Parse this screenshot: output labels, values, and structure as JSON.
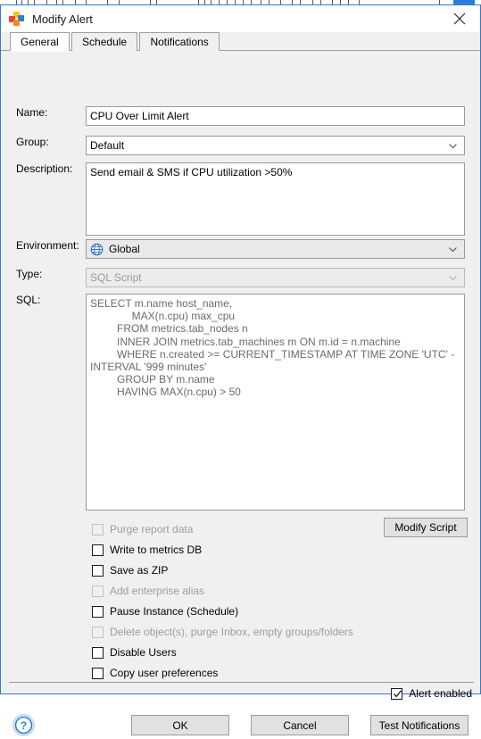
{
  "window": {
    "title": "Modify Alert",
    "app_icon": "squares-logo-icon",
    "close_label": "×"
  },
  "tabs": [
    {
      "label": "General",
      "active": true
    },
    {
      "label": "Schedule",
      "active": false
    },
    {
      "label": "Notifications",
      "active": false
    }
  ],
  "form": {
    "name": {
      "label": "Name:",
      "value": "CPU Over Limit Alert",
      "placeholder": ""
    },
    "group": {
      "label": "Group:",
      "value": "Default"
    },
    "description": {
      "label": "Description:",
      "value": "Send email & SMS if CPU utilization >50%",
      "placeholder": ""
    },
    "environment": {
      "label": "Environment:",
      "value": "Global",
      "icon": "globe-icon"
    },
    "type": {
      "label": "Type:",
      "value": "SQL Script",
      "disabled": true
    },
    "sql": {
      "label": "SQL:",
      "value": "SELECT m.name host_name,\n              MAX(n.cpu) max_cpu\n         FROM metrics.tab_nodes n\n         INNER JOIN metrics.tab_machines m ON m.id = n.machine\n         WHERE n.created >= CURRENT_TIMESTAMP AT TIME ZONE 'UTC' -\nINTERVAL '999 minutes'\n         GROUP BY m.name\n         HAVING MAX(n.cpu) > 50"
    }
  },
  "modify_script_button": "Modify Script",
  "checkboxes": [
    {
      "label": "Purge report data",
      "checked": false,
      "disabled": true
    },
    {
      "label": "Write to metrics DB",
      "checked": false,
      "disabled": false
    },
    {
      "label": "Save as ZIP",
      "checked": false,
      "disabled": false
    },
    {
      "label": "Add enterprise alias",
      "checked": false,
      "disabled": true
    },
    {
      "label": "Pause Instance (Schedule)",
      "checked": false,
      "disabled": false
    },
    {
      "label": "Delete object(s), purge Inbox, empty groups/folders",
      "checked": false,
      "disabled": true
    },
    {
      "label": "Disable Users",
      "checked": false,
      "disabled": false
    },
    {
      "label": "Copy user preferences",
      "checked": false,
      "disabled": false
    }
  ],
  "alert_enabled": {
    "label": "Alert enabled",
    "checked": true
  },
  "footer": {
    "help_icon": "help-question-icon",
    "ok": "OK",
    "cancel": "Cancel",
    "test_notifications": "Test Notifications"
  },
  "colors": {
    "window_border": "#2c7cd6",
    "dialog_bg": "#f0f0f0",
    "field_bg": "#ffffff",
    "disabled_text": "#9d9d9d",
    "accent_blue": "#2c7cd6"
  }
}
